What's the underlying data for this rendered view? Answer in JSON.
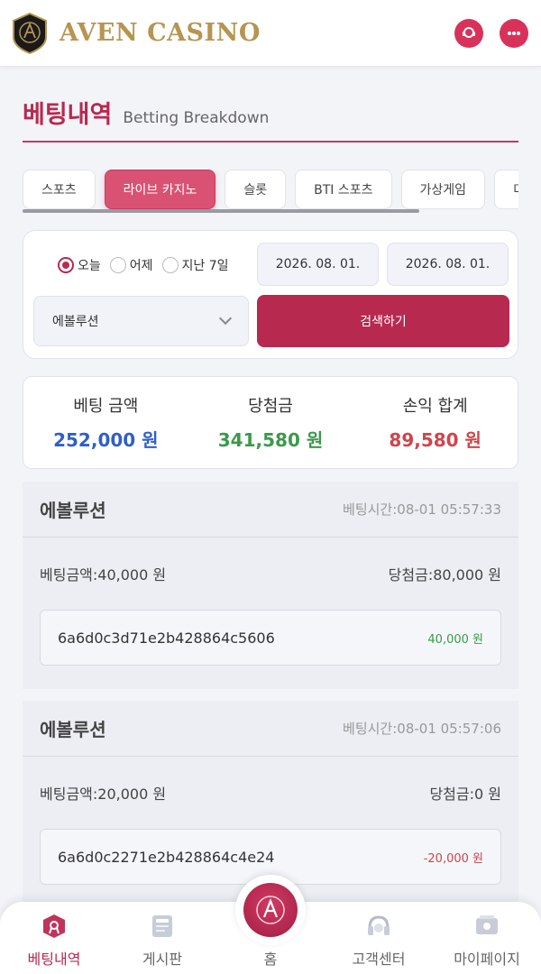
{
  "header": {
    "logo_text": "AVEN CASINO",
    "icons": [
      "support-icon",
      "chat-icon"
    ]
  },
  "page": {
    "title": "베팅내역",
    "subtitle": "Betting Breakdown"
  },
  "tabs": [
    {
      "label": "스포츠"
    },
    {
      "label": "라이브 카지노",
      "active": true
    },
    {
      "label": "슬롯"
    },
    {
      "label": "BTI 스포츠"
    },
    {
      "label": "가상게임"
    },
    {
      "label": "미니게"
    }
  ],
  "filter": {
    "radios": [
      {
        "label": "오늘",
        "selected": true
      },
      {
        "label": "어제"
      },
      {
        "label": "지난 7일"
      }
    ],
    "date_from": "2026. 08. 01.",
    "date_to": "2026. 08. 01.",
    "provider": "에볼루션",
    "search_label": "검색하기"
  },
  "summary": {
    "bet_label": "베팅 금액",
    "bet_value": "252,000 원",
    "win_label": "당첨금",
    "win_value": "341,580 원",
    "profit_label": "손익 합계",
    "profit_value": "89,580 원"
  },
  "records": [
    {
      "provider": "에볼루션",
      "time": "베팅시간:08-01 05:57:33",
      "bet": "베팅금액:40,000 원",
      "win": "당첨금:80,000 원",
      "id": "6a6d0c3d71e2b428864c5606",
      "profit": "40,000 원",
      "profit_color": "#3a9a4a"
    },
    {
      "provider": "에볼루션",
      "time": "베팅시간:08-01 05:57:06",
      "bet": "베팅금액:20,000 원",
      "win": "당첨금:0 원",
      "id": "6a6d0c2271e2b428864c4e24",
      "profit": "-20,000 원",
      "profit_color": "#d0444b"
    }
  ],
  "colors": {
    "accent": "#b8294f",
    "bet_blue": "#2f5fc8",
    "win_green": "#3a9a4a",
    "loss_red": "#d0444b",
    "logo_gold": "#b69551"
  },
  "nav": {
    "betting": "베팅내역",
    "board": "게시판",
    "home": "홈",
    "support": "고객센터",
    "mypage": "마이페이지"
  }
}
